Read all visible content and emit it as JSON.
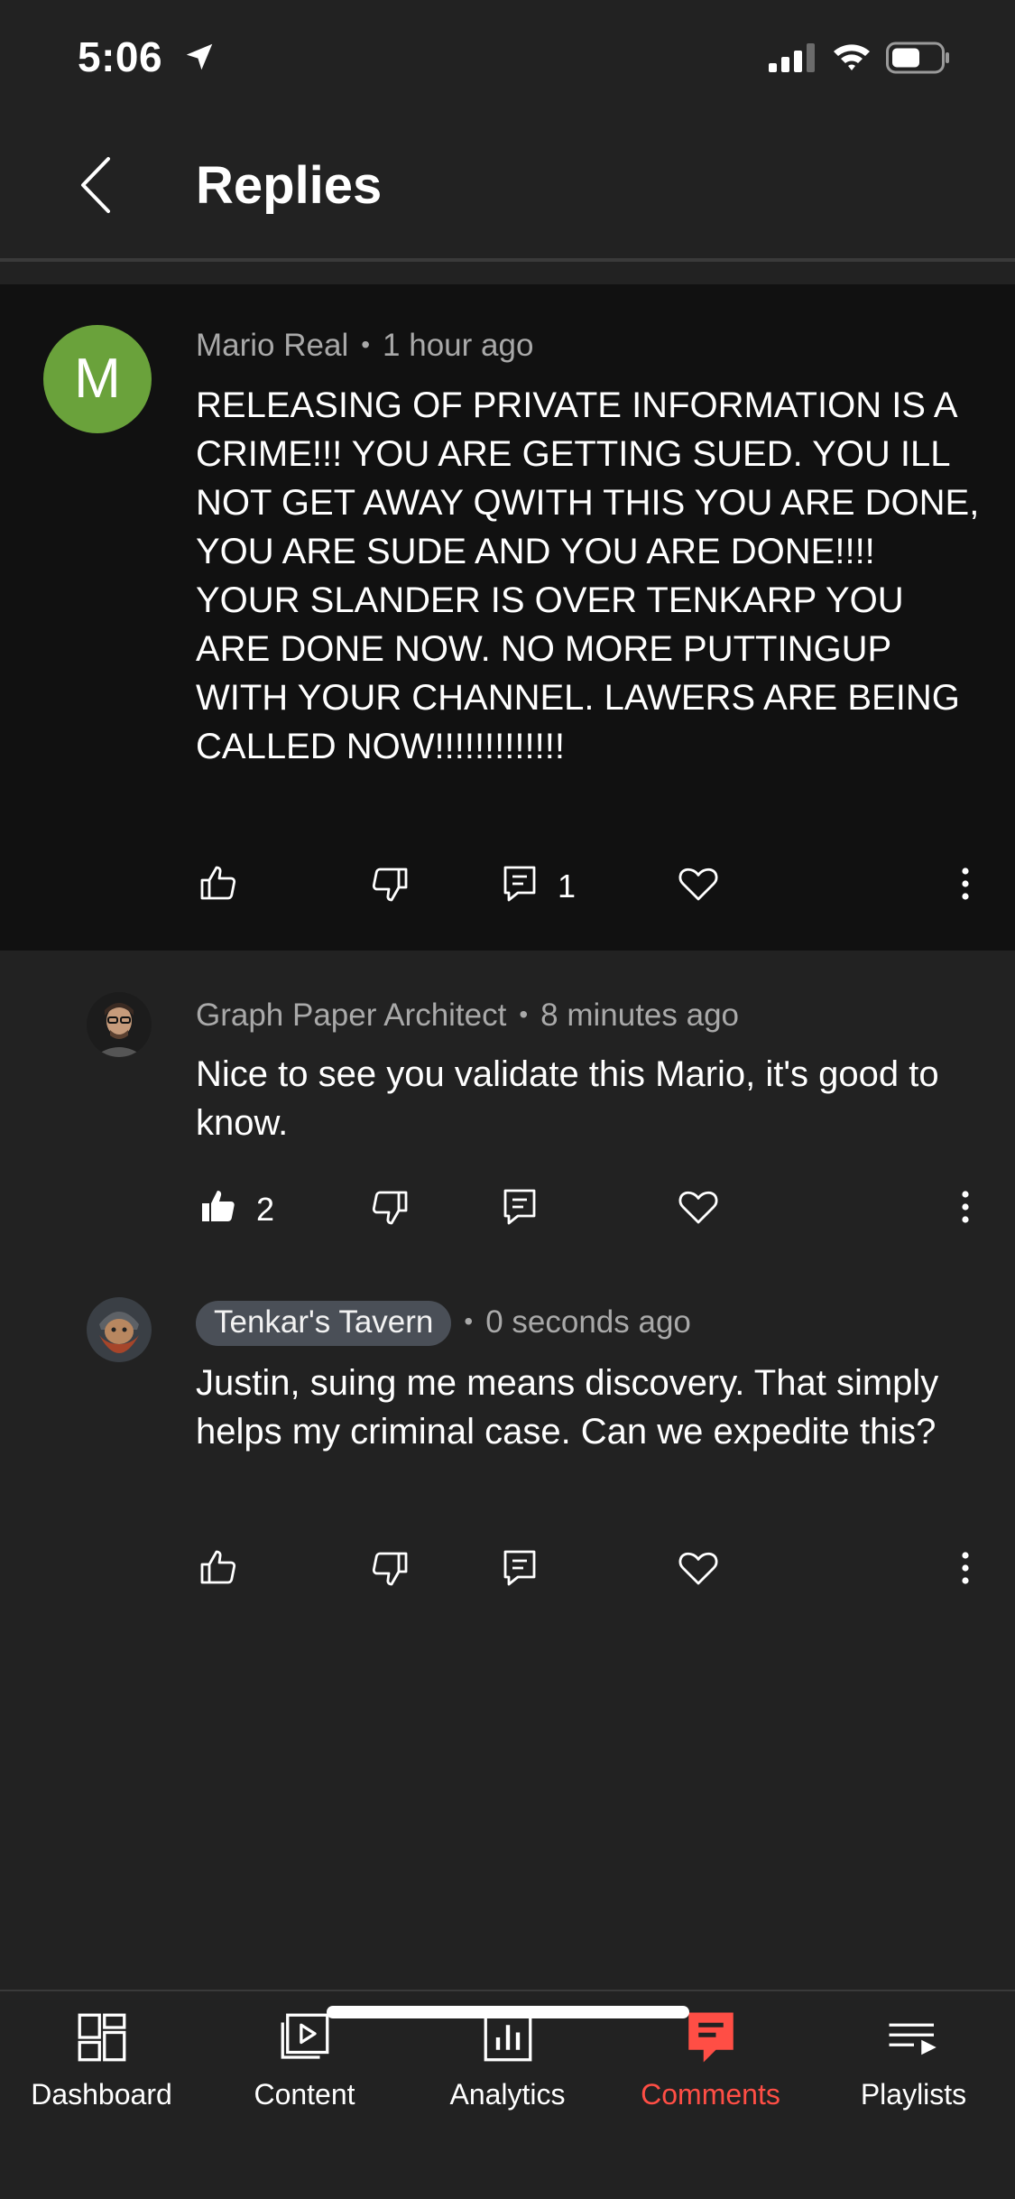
{
  "status_bar": {
    "time": "5:06"
  },
  "header": {
    "title": "Replies"
  },
  "comments": [
    {
      "author": "Mario Real",
      "time": "1 hour ago",
      "avatar_letter": "M",
      "text": "RELEASING OF PRIVATE INFORMATION IS A CRIME!!! YOU ARE GETTING SUED. YOU ILL NOT GET AWAY QWITH THIS YOU ARE DONE, YOU ARE SUDE AND YOU ARE DONE!!!! YOUR SLANDER IS OVER TENKARP YOU ARE DONE NOW. NO MORE PUTTINGUP WITH YOUR CHANNEL. LAWERS ARE BEING CALLED NOW!!!!!!!!!!!!!",
      "reply_count": "1"
    },
    {
      "author": "Graph Paper Architect",
      "time": "8 minutes ago",
      "text": "Nice to see you validate this Mario, it's good to know.",
      "like_count": "2"
    },
    {
      "author": "Tenkar's Tavern",
      "time": "0 seconds ago",
      "text": "Justin, suing me means discovery. That simply helps my criminal case. Can we expedite this?"
    }
  ],
  "bottom_nav": {
    "items": [
      {
        "label": "Dashboard",
        "icon": "dashboard-icon"
      },
      {
        "label": "Content",
        "icon": "content-icon"
      },
      {
        "label": "Analytics",
        "icon": "analytics-icon"
      },
      {
        "label": "Comments",
        "icon": "comments-icon",
        "active": true
      },
      {
        "label": "Playlists",
        "icon": "playlists-icon"
      }
    ]
  },
  "colors": {
    "accent": "#ff4e45",
    "avatar_green": "#6aa23b",
    "background": "#222222",
    "parent_background": "#111111"
  }
}
